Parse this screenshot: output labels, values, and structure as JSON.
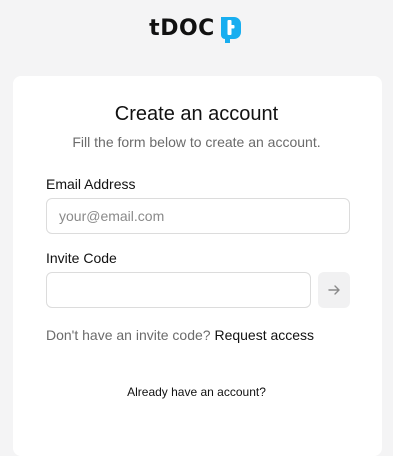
{
  "brand": {
    "name": "tDOC",
    "accent_color": "#18aef0",
    "logo_mark_icon": "tdoc-logo-mark"
  },
  "form": {
    "title": "Create an account",
    "subtitle": "Fill the form below to create an account.",
    "email": {
      "label": "Email Address",
      "placeholder": "your@email.com",
      "value": ""
    },
    "invite": {
      "label": "Invite Code",
      "placeholder": "",
      "value": "",
      "submit_icon": "arrow-right-icon"
    },
    "request": {
      "question": "Don't have an invite code?",
      "link_label": "Request access"
    },
    "signin_prompt": "Already have an account?"
  }
}
